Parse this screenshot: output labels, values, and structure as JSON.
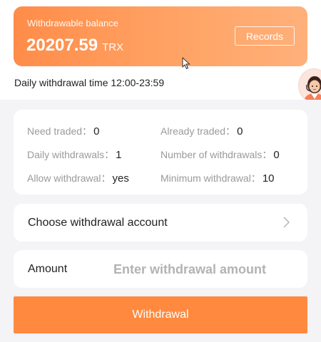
{
  "balance": {
    "label": "Withdrawable balance",
    "amount": "20207.59",
    "currency": "TRX",
    "records_label": "Records"
  },
  "withdrawal_time": "Daily withdrawal time 12:00-23:59",
  "info": {
    "need_traded_label": "Need traded：",
    "need_traded_value": "0",
    "already_traded_label": "Already traded：",
    "already_traded_value": "0",
    "daily_withdrawals_label": "Daily withdrawals：",
    "daily_withdrawals_value": "1",
    "number_of_withdrawals_label": "Number of withdrawals：",
    "number_of_withdrawals_value": "0",
    "allow_withdrawal_label": "Allow withdrawal：",
    "allow_withdrawal_value": "yes",
    "minimum_withdrawal_label": "Minimum withdrawal：",
    "minimum_withdrawal_value": "10"
  },
  "account": {
    "label": "Choose withdrawal account"
  },
  "amount": {
    "label": "Amount",
    "placeholder": "Enter withdrawal amount"
  },
  "withdraw_button": "Withdrawal",
  "colors": {
    "accent": "#ff8a3f",
    "card_gradient_start": "#ff8c49",
    "card_gradient_end": "#ffb07a",
    "muted_text": "#9a9a9a"
  }
}
